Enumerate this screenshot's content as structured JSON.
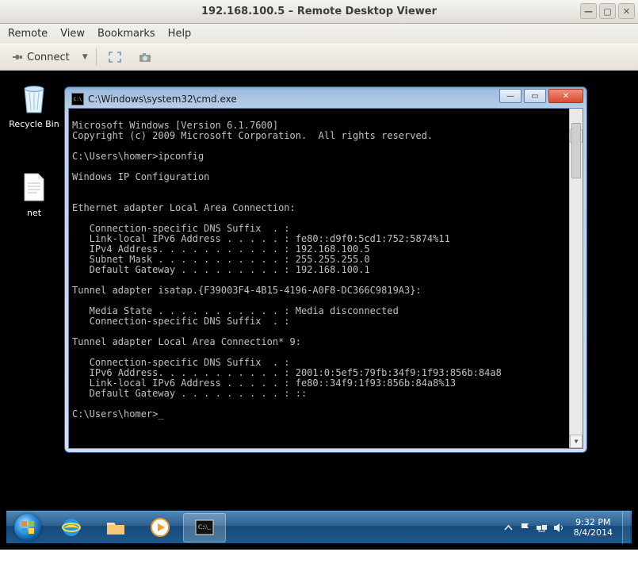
{
  "gnome": {
    "title": "192.168.100.5 – Remote Desktop Viewer",
    "menu": {
      "remote": "Remote",
      "view": "View",
      "bookmarks": "Bookmarks",
      "help": "Help"
    },
    "toolbar": {
      "connect": "Connect"
    }
  },
  "desktop": {
    "icons": {
      "recycle": "Recycle Bin",
      "net": "net"
    }
  },
  "cmd": {
    "title": "C:\\Windows\\system32\\cmd.exe",
    "lines": [
      "Microsoft Windows [Version 6.1.7600]",
      "Copyright (c) 2009 Microsoft Corporation.  All rights reserved.",
      "",
      "C:\\Users\\homer>ipconfig",
      "",
      "Windows IP Configuration",
      "",
      "",
      "Ethernet adapter Local Area Connection:",
      "",
      "   Connection-specific DNS Suffix  . :",
      "   Link-local IPv6 Address . . . . . : fe80::d9f0:5cd1:752:5874%11",
      "   IPv4 Address. . . . . . . . . . . : 192.168.100.5",
      "   Subnet Mask . . . . . . . . . . . : 255.255.255.0",
      "   Default Gateway . . . . . . . . . : 192.168.100.1",
      "",
      "Tunnel adapter isatap.{F39003F4-4B15-4196-A0F8-DC366C9819A3}:",
      "",
      "   Media State . . . . . . . . . . . : Media disconnected",
      "   Connection-specific DNS Suffix  . :",
      "",
      "Tunnel adapter Local Area Connection* 9:",
      "",
      "   Connection-specific DNS Suffix  . :",
      "   IPv6 Address. . . . . . . . . . . : 2001:0:5ef5:79fb:34f9:1f93:856b:84a8",
      "   Link-local IPv6 Address . . . . . : fe80::34f9:1f93:856b:84a8%13",
      "   Default Gateway . . . . . . . . . : ::",
      "",
      "C:\\Users\\homer>"
    ]
  },
  "taskbar": {
    "time": "9:32 PM",
    "date": "8/4/2014"
  }
}
